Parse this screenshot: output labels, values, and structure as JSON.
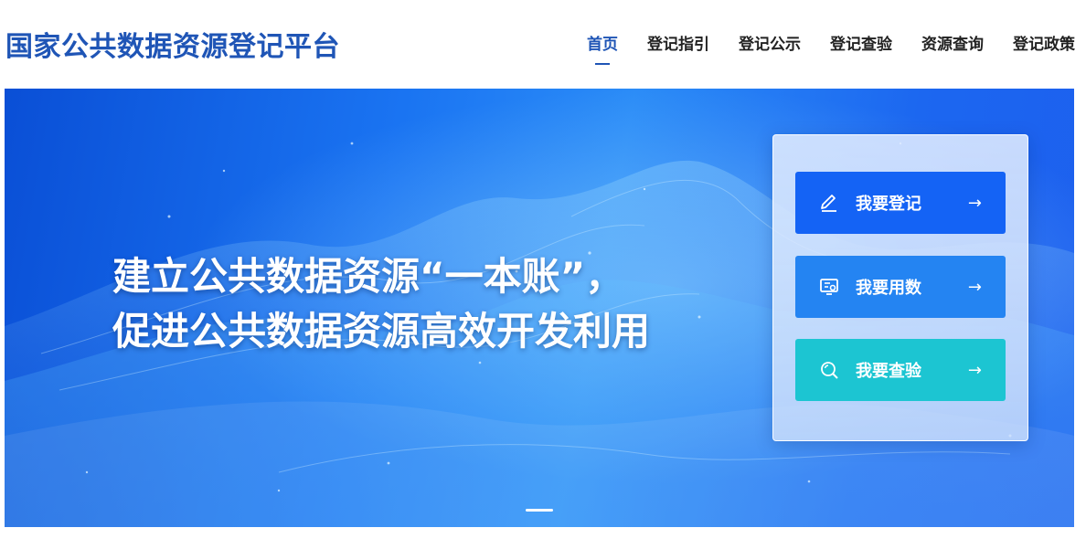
{
  "header": {
    "site_title": "国家公共数据资源登记平台",
    "nav": [
      {
        "label": "首页",
        "active": true
      },
      {
        "label": "登记指引",
        "active": false
      },
      {
        "label": "登记公示",
        "active": false
      },
      {
        "label": "登记查验",
        "active": false
      },
      {
        "label": "资源查询",
        "active": false
      },
      {
        "label": "登记政策",
        "active": false
      }
    ]
  },
  "banner": {
    "slogan_line1": "建立公共数据资源“一本账”，",
    "slogan_line2": "促进公共数据资源高效开发利用",
    "slide_count_indicator": 1
  },
  "actions": [
    {
      "label": "我要登记",
      "icon": "pen-icon",
      "arrow": "→",
      "color": "#1463f5"
    },
    {
      "label": "我要用数",
      "icon": "data-screen-icon",
      "arrow": "→",
      "color": "#2484f2"
    },
    {
      "label": "我要查验",
      "icon": "search-icon",
      "arrow": "→",
      "color": "#1cc5d2"
    }
  ],
  "colors": {
    "brand": "#1f55b6",
    "banner_blue": "#1a74f2"
  }
}
